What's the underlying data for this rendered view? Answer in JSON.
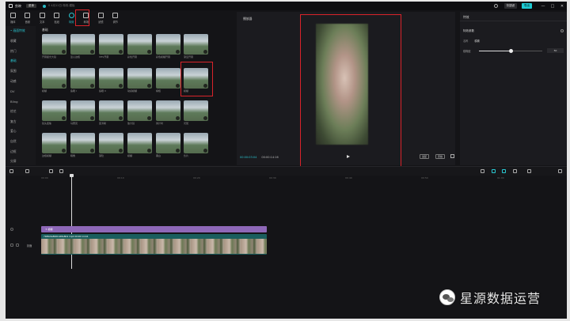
{
  "titlebar": {
    "app_name": "剪映",
    "menu_label": "菜单",
    "project_label": "0  4月11日-特效-模板",
    "shortcut_label": "快捷键",
    "export_label": "导出",
    "win_minimize": "—",
    "win_maximize": "□",
    "win_close": "✕"
  },
  "toolbar": {
    "items": [
      {
        "label": "媒体",
        "icon": "media-icon"
      },
      {
        "label": "音频",
        "icon": "audio-icon"
      },
      {
        "label": "文本",
        "icon": "text-icon"
      },
      {
        "label": "贴纸",
        "icon": "sticker-icon"
      },
      {
        "label": "特效",
        "icon": "effects-icon",
        "active": true
      },
      {
        "label": "转场",
        "icon": "transition-icon"
      },
      {
        "label": "滤镜",
        "icon": "filter-icon"
      },
      {
        "label": "调节",
        "icon": "adjust-icon"
      }
    ]
  },
  "sidebar": {
    "items": [
      {
        "label": "• 画面特效",
        "active": true
      },
      {
        "label": "收藏"
      },
      {
        "label": "热门"
      },
      {
        "label": "基础",
        "active": true
      },
      {
        "label": "氛围"
      },
      {
        "label": "动感"
      },
      {
        "label": "DV"
      },
      {
        "label": "Bling"
      },
      {
        "label": "综艺"
      },
      {
        "label": "复古"
      },
      {
        "label": "爱心"
      },
      {
        "label": "自然"
      },
      {
        "label": "边框"
      },
      {
        "label": "分屏"
      }
    ]
  },
  "library": {
    "header": "基础",
    "rows": [
      [
        "开幕星光大镜",
        "爱心边框",
        "VHS开幕",
        "彩色开幕",
        "彩色模糊开幕",
        "渐显开幕"
      ],
      [
        "模糊",
        "鱼眼 I",
        "鱼眼 II",
        "动感模糊",
        "横框",
        "模糊"
      ],
      [
        "镜头变焦",
        "马赛克",
        "变清晰",
        "放大镜",
        "倒计时",
        "光斑"
      ],
      [
        "边框模糊",
        "暗角",
        "渐隐",
        "模糊",
        "黑白",
        "负片"
      ]
    ]
  },
  "player": {
    "title": "播放器",
    "current_time": "00:00:03:04",
    "total_time": "00:00:14:16",
    "btn_original": "适配",
    "btn_ratio": "原始"
  },
  "inspector": {
    "tab": "特效",
    "section": "特效参数",
    "name_label": "名称",
    "name_value": "模糊",
    "param_label": "模糊度",
    "param_value": "50",
    "param_fraction": 0.5
  },
  "timeline": {
    "ticks": [
      "00:00",
      "00:10",
      "00:20",
      "00:30",
      "00:40",
      "00:50",
      "01:00"
    ],
    "fx_clip_label": "✦ 模糊",
    "video_clip_label": "7bf6b0e8991b48e8b9 mp4  00:00:14:16",
    "cover_label": "封面"
  },
  "watermark": {
    "text": "星源数据运营"
  },
  "colors": {
    "accent": "#2ac7d2",
    "highlight": "#d9232a",
    "fx_track": "#8e68b8",
    "video_track": "#1a5e5e"
  }
}
